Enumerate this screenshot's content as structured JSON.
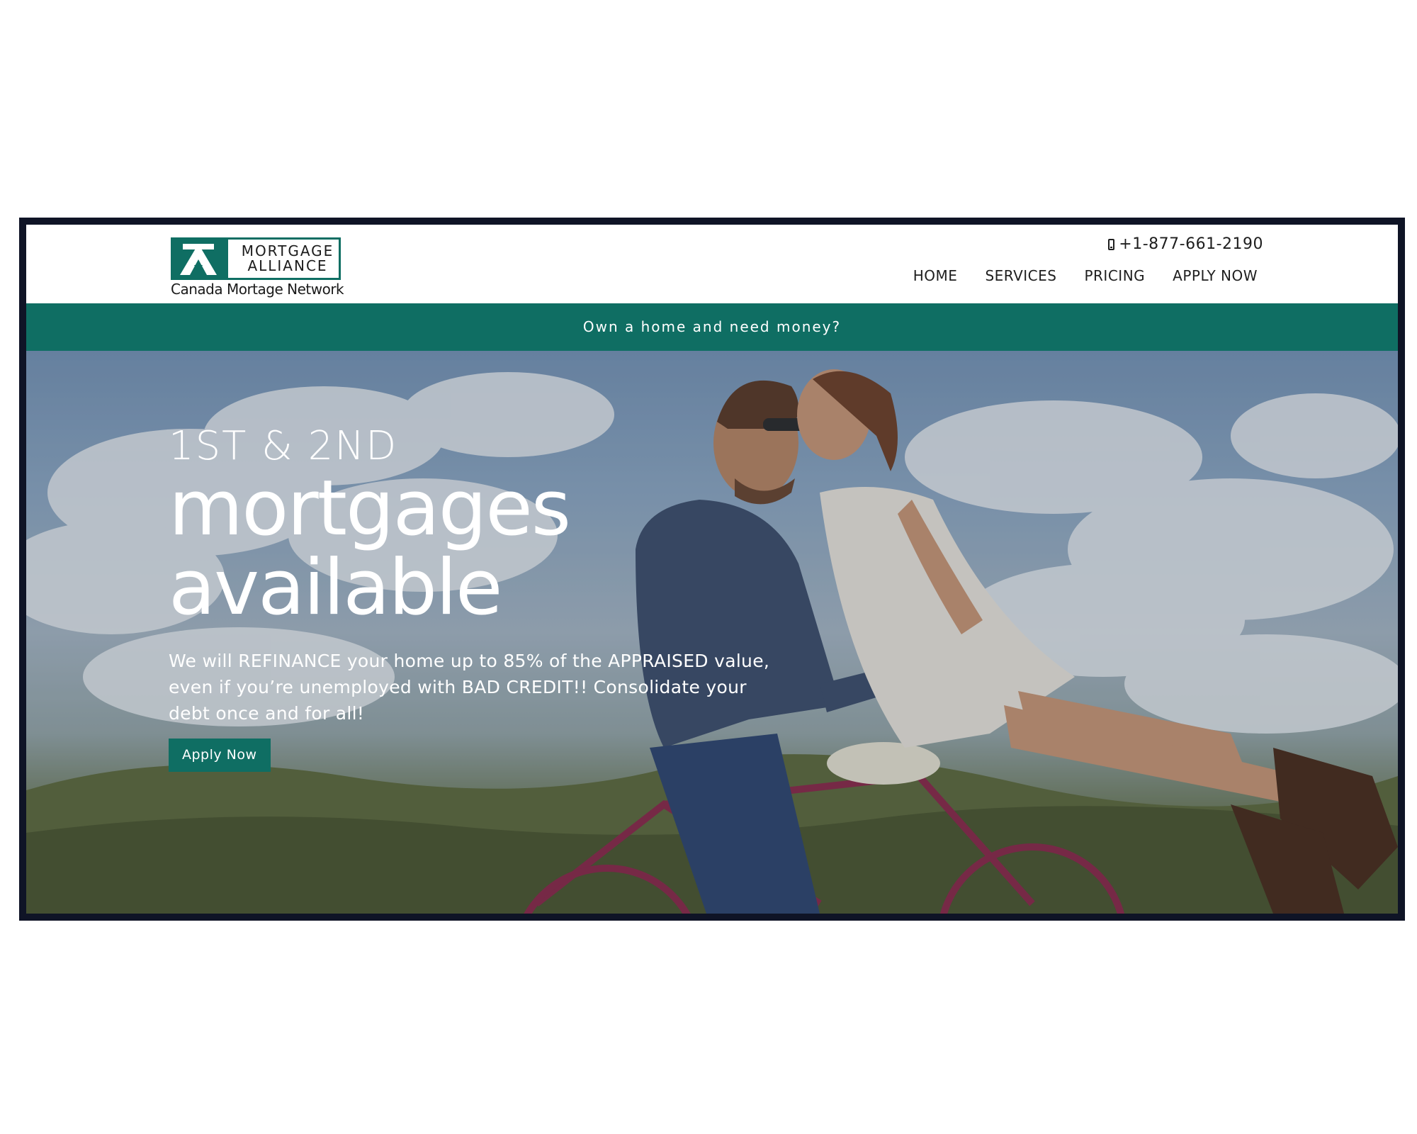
{
  "header": {
    "logo": {
      "line1": "MORTGAGE",
      "line2": "ALLIANCE",
      "tagline": "Canada Mortage Network"
    },
    "phone": "+1-877-661-2190",
    "phone_icon": "mobile-phone-icon",
    "nav": [
      "HOME",
      "SERVICES",
      "PRICING",
      "APPLY NOW"
    ]
  },
  "banner": {
    "text": "Own a home and need money?"
  },
  "hero": {
    "pre_title": "1ST & 2ND",
    "title_line1": "mortgages",
    "title_line2": "available",
    "body": "We will REFINANCE your home up to 85% of the APPRAISED value, even if you’re unemployed with BAD CREDIT!! Consolidate your debt once and for all!",
    "cta": "Apply Now"
  },
  "colors": {
    "brand_green": "#0f6e63",
    "frame": "#0f1426",
    "text_dark": "#1e1e1e"
  }
}
